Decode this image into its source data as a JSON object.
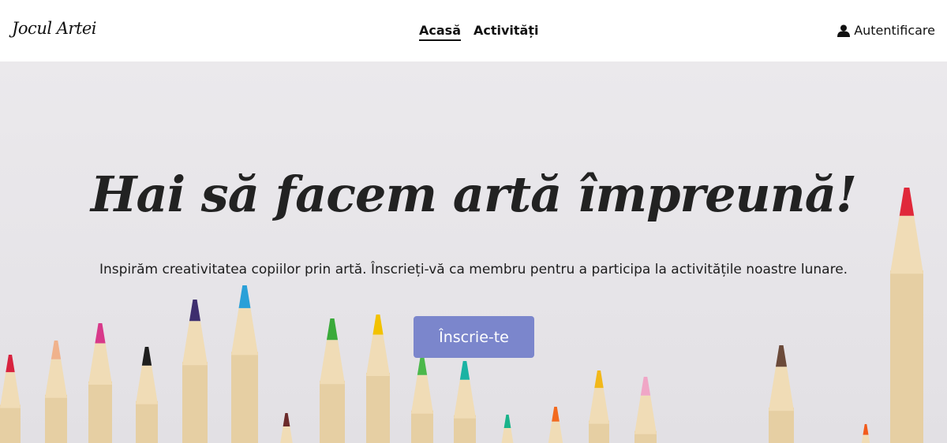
{
  "navbar": {
    "logo": "Jocul Artei",
    "links": [
      {
        "label": "Acasă",
        "active": true
      },
      {
        "label": "Activități",
        "active": false
      }
    ],
    "login_label": "Autentificare",
    "login_icon": "user-icon"
  },
  "hero": {
    "headline": "Hai să facem artă împreună!",
    "subtitle": "Inspirăm creativitatea copiilor prin artă. Înscrieți-vă ca membru pentru a participa la activitățile noastre lunare.",
    "cta_label": "Înscrie-te",
    "cta_color": "#7b86cc",
    "background": "colored pencils"
  }
}
